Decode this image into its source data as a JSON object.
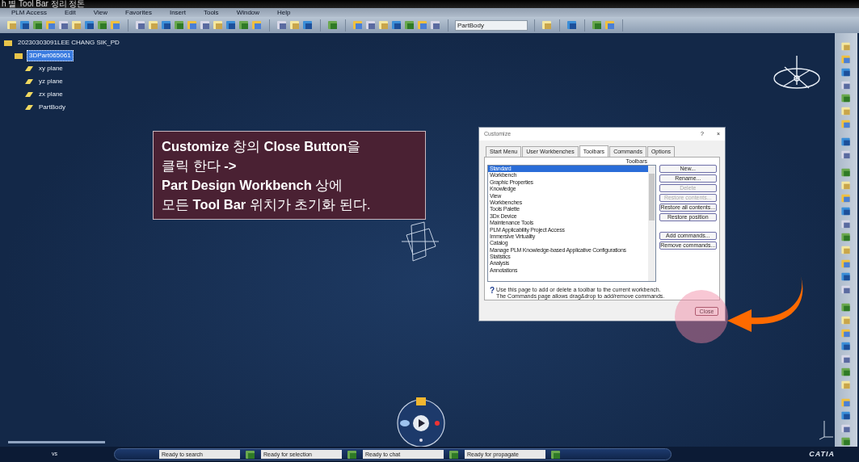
{
  "window": {
    "title": "h 별 Tool Bar 정리 정돈"
  },
  "menu": [
    "PLM Access",
    "Edit",
    "View",
    "Favorites",
    "Insert",
    "Tools",
    "Window",
    "Help"
  ],
  "toolbar": {
    "combo_value": "PartBody"
  },
  "tree": [
    {
      "label": "20230303091LEE CHANG SIK_PD",
      "selected": false,
      "children": [
        {
          "label": "3DPart065061",
          "selected": true,
          "children": [
            {
              "label": "xy plane",
              "selected": false
            },
            {
              "label": "yz plane",
              "selected": false
            },
            {
              "label": "zx plane",
              "selected": false
            },
            {
              "label": "PartBody",
              "selected": false
            }
          ]
        }
      ]
    }
  ],
  "callout": {
    "lines": [
      "**Customize** 창의 **Close Button**을",
      "클릭 한다 **->**",
      "**Part Design Workbench** 상에",
      "모든 **Tool Bar** 위치가 초기화 된다."
    ]
  },
  "dialog": {
    "title": "Customize",
    "help": "?",
    "close": "×",
    "tabs": [
      {
        "label": "Start Menu",
        "selected": false
      },
      {
        "label": "User Workbenches",
        "selected": false
      },
      {
        "label": "Toolbars",
        "selected": true
      },
      {
        "label": "Commands",
        "selected": false
      },
      {
        "label": "Options",
        "selected": false
      }
    ],
    "list_label": "Toolbars",
    "items": [
      {
        "label": "Standard",
        "selected": true
      },
      {
        "label": "Workbench",
        "selected": false
      },
      {
        "label": "Graphic Properties",
        "selected": false
      },
      {
        "label": "Knowledge",
        "selected": false
      },
      {
        "label": "View",
        "selected": false
      },
      {
        "label": "Workbenches",
        "selected": false
      },
      {
        "label": "Tools Palette",
        "selected": false
      },
      {
        "label": "3Dx Device",
        "selected": false
      },
      {
        "label": "Maintenance Tools",
        "selected": false
      },
      {
        "label": "PLM Applicability Project Access",
        "selected": false
      },
      {
        "label": "Immersive Virtuality",
        "selected": false
      },
      {
        "label": "Catalog",
        "selected": false
      },
      {
        "label": "Manage PLM Knowledge-based Applicative Configurations",
        "selected": false
      },
      {
        "label": "Statistics",
        "selected": false
      },
      {
        "label": "Analysis",
        "selected": false
      },
      {
        "label": "Annotations",
        "selected": false
      }
    ],
    "buttons": [
      {
        "label": "New...",
        "disabled": false
      },
      {
        "label": "Rename...",
        "disabled": false
      },
      {
        "label": "Delete",
        "disabled": true
      },
      {
        "label": "Restore contents...",
        "disabled": true
      },
      {
        "label": "Restore all contents...",
        "disabled": false
      },
      {
        "label": "Restore position",
        "disabled": false
      },
      {
        "label": "Add commands...",
        "disabled": false
      },
      {
        "label": "Remove commands...",
        "disabled": false
      }
    ],
    "hint_icon": "?",
    "hint": [
      "Use this page to add or delete a toolbar to the current workbench.",
      "The Commands page allows drag&drop to add/remove commands."
    ],
    "close_button": "Close"
  },
  "status_bar": {
    "user": "vs",
    "fields": [
      "Ready to search",
      "Ready for selection",
      "Ready to chat",
      "Ready for propagate"
    ],
    "logo": "CATIA"
  }
}
